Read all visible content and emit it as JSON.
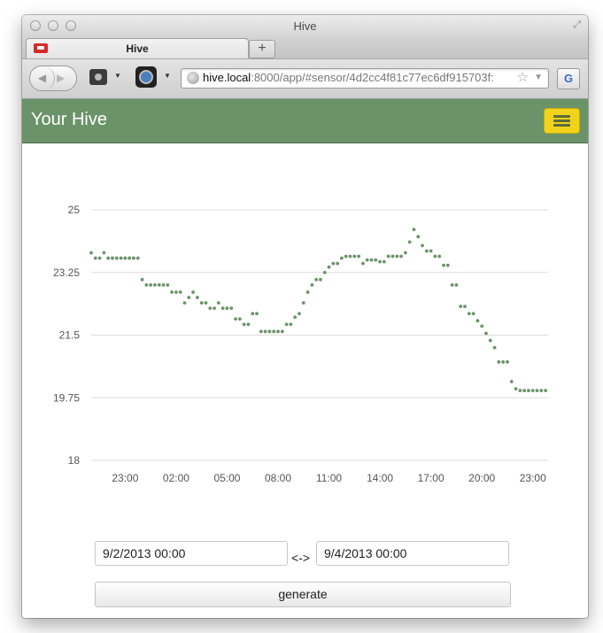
{
  "window": {
    "title": "Hive"
  },
  "tab": {
    "title": "Hive",
    "new_tab": "+"
  },
  "toolbar": {
    "url_host": "hive.local",
    "url_rest": ":8000/app/#sensor/4d2cc4f81c77ec6df915703f:"
  },
  "header": {
    "brand": "Your Hive"
  },
  "colors": {
    "accent": "#6b9369",
    "menu_button": "#f1d31c",
    "point": "#6b9369",
    "grid": "#dddddd"
  },
  "chart_data": {
    "type": "scatter",
    "title": "",
    "xlabel": "",
    "ylabel": "",
    "grid": true,
    "ylim": [
      18,
      25
    ],
    "y_ticks": [
      "25",
      "23.25",
      "21.5",
      "19.75",
      "18"
    ],
    "x_tick_labels": [
      "23:00",
      "02:00",
      "05:00",
      "08:00",
      "11:00",
      "14:00",
      "17:00",
      "20:00",
      "23:00"
    ],
    "x_ticks_hours": [
      23,
      26,
      29,
      32,
      35,
      38,
      41,
      44,
      47
    ],
    "xlim_hours": [
      21,
      47.9
    ],
    "series": [
      {
        "x_hours": [
          21.0,
          21.25,
          21.5,
          21.75,
          22.0,
          22.25,
          22.5,
          22.75,
          23.0,
          23.25,
          23.5,
          23.75,
          24.0,
          24.25,
          24.5,
          24.75,
          25.0,
          25.25,
          25.5,
          25.75,
          26.0,
          26.25,
          26.5,
          26.75,
          27.0,
          27.25,
          27.5,
          27.75,
          28.0,
          28.25,
          28.5,
          28.75,
          29.0,
          29.25,
          29.5,
          29.75,
          30.0,
          30.25,
          30.5,
          30.75,
          31.0,
          31.25,
          31.5,
          31.75,
          32.0,
          32.25,
          32.5,
          32.75,
          33.0,
          33.25,
          33.5,
          33.75,
          34.0,
          34.25,
          34.5,
          34.75,
          35.0,
          35.25,
          35.5,
          35.75,
          36.0,
          36.25,
          36.5,
          36.75,
          37.0,
          37.25,
          37.5,
          37.75,
          38.0,
          38.25,
          38.5,
          38.75,
          39.0,
          39.25,
          39.5,
          39.75,
          40.0,
          40.25,
          40.5,
          40.75,
          41.0,
          41.25,
          41.5,
          41.75,
          42.0,
          42.25,
          42.5,
          42.75,
          43.0,
          43.25,
          43.5,
          43.75,
          44.0,
          44.25,
          44.5,
          44.75,
          45.0,
          45.25,
          45.5,
          45.75,
          46.0,
          46.25,
          46.5,
          46.75,
          47.0,
          47.25,
          47.5,
          47.75
        ],
        "values": [
          23.8,
          23.65,
          23.65,
          23.8,
          23.65,
          23.65,
          23.65,
          23.65,
          23.65,
          23.65,
          23.65,
          23.65,
          23.05,
          22.9,
          22.9,
          22.9,
          22.9,
          22.9,
          22.9,
          22.7,
          22.7,
          22.7,
          22.4,
          22.55,
          22.7,
          22.55,
          22.4,
          22.4,
          22.25,
          22.25,
          22.4,
          22.25,
          22.25,
          22.25,
          21.95,
          21.95,
          21.8,
          21.8,
          22.1,
          22.1,
          21.6,
          21.6,
          21.6,
          21.6,
          21.6,
          21.6,
          21.8,
          21.8,
          22.0,
          22.1,
          22.4,
          22.7,
          22.9,
          23.05,
          23.05,
          23.25,
          23.4,
          23.5,
          23.5,
          23.65,
          23.7,
          23.7,
          23.7,
          23.7,
          23.5,
          23.6,
          23.6,
          23.6,
          23.55,
          23.55,
          23.7,
          23.7,
          23.7,
          23.7,
          23.8,
          24.1,
          24.45,
          24.25,
          24.0,
          23.85,
          23.85,
          23.7,
          23.7,
          23.45,
          23.45,
          22.9,
          22.9,
          22.3,
          22.3,
          22.1,
          22.1,
          21.9,
          21.75,
          21.55,
          21.35,
          21.15,
          20.75,
          20.75,
          20.75,
          20.2,
          20.0,
          19.95,
          19.95,
          19.95,
          19.95,
          19.95,
          19.95,
          19.95
        ]
      }
    ]
  },
  "form": {
    "start_date": "9/2/2013 00:00",
    "separator": "<->",
    "end_date": "9/4/2013 00:00",
    "generate_label": "generate"
  }
}
